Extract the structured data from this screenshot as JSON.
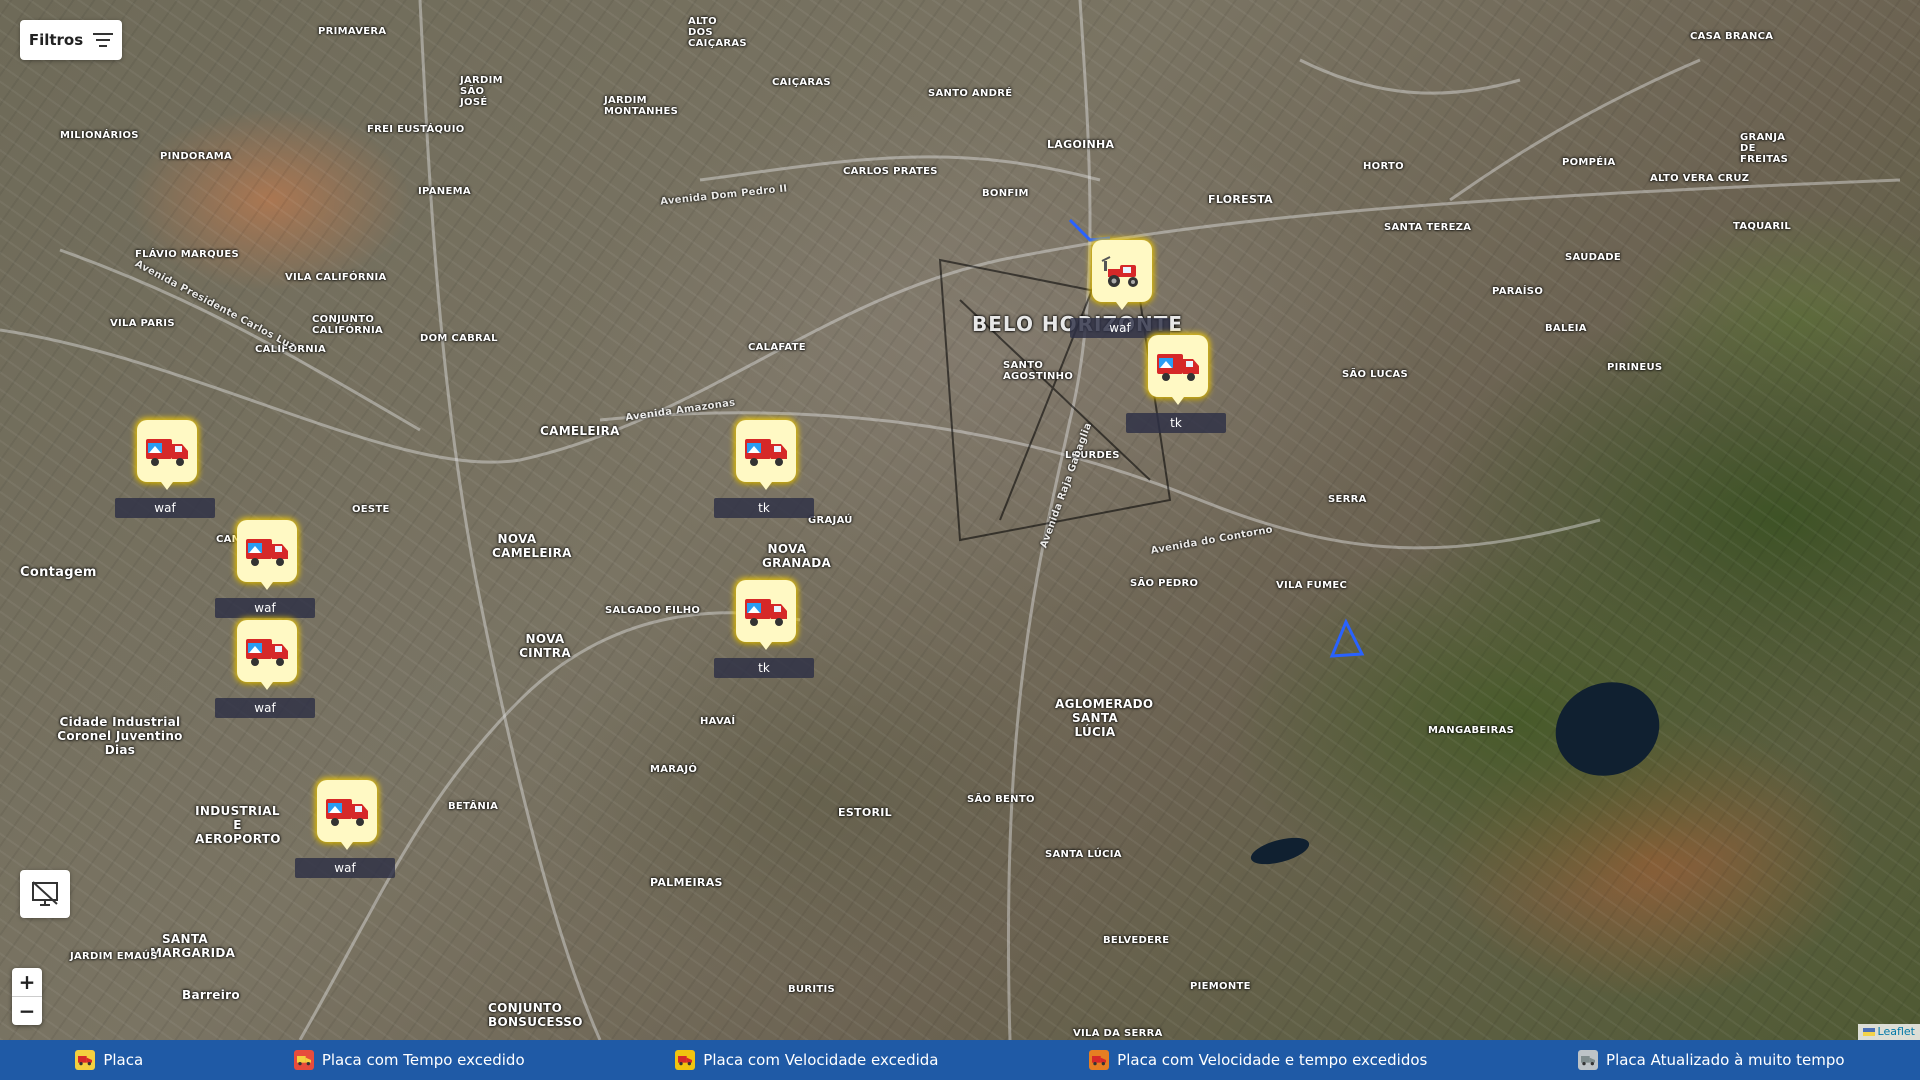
{
  "filters_button": {
    "label": "Filtros"
  },
  "map": {
    "city_label": "BELO HORIZONTE",
    "places": [
      "PRIMAVERA",
      "ALTO DOS CAIÇARAS",
      "JARDIM SÃO JOSÉ",
      "JARDIM MONTANHES",
      "CAIÇARAS",
      "SANTO ANDRÉ",
      "LAGOINHA",
      "FLORESTA",
      "HORTO",
      "POMPÉIA",
      "CASA BRANCA",
      "MILIONÁRIOS",
      "PINDORAMA",
      "FREI EUSTÁQUIO",
      "CARLOS PRATES",
      "BONFIM",
      "IPANEMA",
      "SANTA TEREZA",
      "ALTO VERA CRUZ",
      "GRANJA DE FREITAS",
      "TAQUARIL",
      "SAUDADE",
      "FLÁVIO MARQUES",
      "VILA CALIFÓRNIA",
      "CONJUNTO CALIFÓRNIA",
      "VILA PARIS",
      "CALIFÓRNIA",
      "DOM CABRAL",
      "CALAFATE",
      "PARAÍSO",
      "BALEIA",
      "CAMELEIRA",
      "SANTO AGOSTINHO",
      "SÃO LUCAS",
      "PIRINEUS",
      "LOURDES",
      "OESTE",
      "SERRA",
      "CAMARGOS",
      "NOVA CAMELEIRA",
      "GRAJAÚ",
      "NOVA GRANADA",
      "SÃO PEDRO",
      "VILA FUMEC",
      "SALGADO FILHO",
      "NOVA CINTRA",
      "AGLOMERADO SANTA LÚCIA",
      "HAVAÍ",
      "MANGABEIRAS",
      "MARAJÓ",
      "ESTORIL",
      "SÃO BENTO",
      "BETÂNIA",
      "SANTA LÚCIA",
      "PALMEIRAS",
      "BELVEDERE",
      "SANTA MARGARIDA",
      "JARDIM EMAÚS",
      "BURITIS",
      "PIEMONTE",
      "Barreiro",
      "CONJUNTO BONSUCESSO",
      "VILA DA SERRA",
      "Contagem",
      "INDUSTRIAL E AEROPORTO",
      "Cidade Industrial Coronel Juventino Dias",
      "Avenida Amazonas",
      "Avenida Dom Pedro II",
      "Avenida Presidente Carlos Luz",
      "Avenida do Contorno",
      "Avenida Raja Gabaglia"
    ]
  },
  "markers": [
    {
      "label": "waf",
      "type": "tractor"
    },
    {
      "label": "tk",
      "type": "truck"
    },
    {
      "label": "waf",
      "type": "truck"
    },
    {
      "label": "tk",
      "type": "truck"
    },
    {
      "label": "waf",
      "type": "truck"
    },
    {
      "label": "tk",
      "type": "truck"
    },
    {
      "label": "waf",
      "type": "truck"
    },
    {
      "label": "waf",
      "type": "truck"
    }
  ],
  "controls": {
    "zoom_in": "+",
    "zoom_out": "−",
    "attribution": "Leaflet"
  },
  "legend": [
    {
      "label": "Placa",
      "color": "#f4d03f"
    },
    {
      "label": "Placa com Tempo excedido",
      "color": "#e74c3c"
    },
    {
      "label": "Placa com Velocidade excedida",
      "color": "#f1c40f"
    },
    {
      "label": "Placa com Velocidade e tempo excedidos",
      "color": "#e67e22"
    },
    {
      "label": "Placa Atualizado à muito tempo",
      "color": "#bdc3c7"
    }
  ],
  "colors": {
    "legend_bg": "#1f5aa6",
    "marker_bg": "#fff9c4",
    "marker_glow": "#ffd600",
    "route": "#2962ff"
  }
}
